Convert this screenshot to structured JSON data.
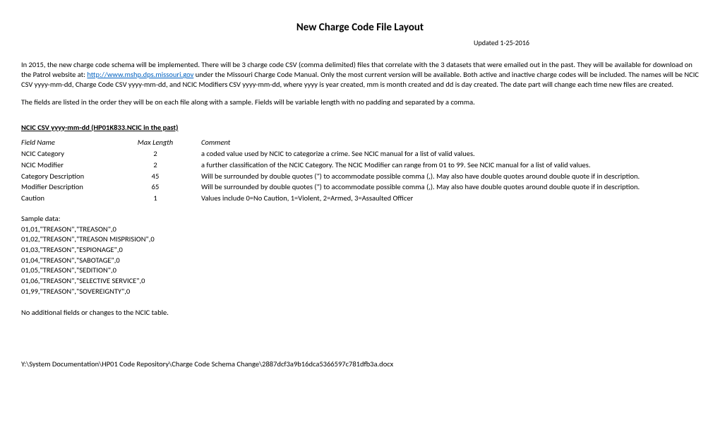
{
  "title": "New Charge Code File Layout",
  "updated": "Updated 1-25-2016",
  "intro": {
    "p1_pre": "In 2015, the new charge code schema will be implemented.  There will be 3 charge code CSV (comma delimited) files that correlate with the 3 datasets that were emailed out in the past.  They will be available for download on the Patrol website at: ",
    "link_text": "http://www.mshp.dps.missouri.gov",
    "p1_post": "  under the Missouri Charge Code Manual.  Only the most current version will be available.  Both active and inactive charge codes will be included.  The names will be NCIC CSV yyyy-mm-dd, Charge Code CSV yyyy-mm-dd, and NCIC Modifiers CSV yyyy-mm-dd, where yyyy is year created, mm is month created and dd is day created.  The date part will change each time new files are created.",
    "p2": "The fields are listed in the order they will be on each file along with a sample.  Fields will be variable length with no padding and separated by a comma."
  },
  "section_heading": "NCIC CSV yyyy-mm-dd (HP01K833.NCIC in the past)",
  "table": {
    "headers": {
      "name": "Field Name",
      "len": "Max Length",
      "comment": "Comment"
    },
    "rows": [
      {
        "name": "NCIC Category",
        "len": "2",
        "comment": "a coded value used by NCIC to categorize a crime.  See NCIC manual for a list of valid values."
      },
      {
        "name": "NCIC Modifier",
        "len": "2",
        "comment": "a further classification of the NCIC Category.  The NCIC Modifier can range from 01 to 99.  See NCIC manual for a list of valid values."
      },
      {
        "name": "Category Description",
        "len": "45",
        "comment": "Will be surrounded by double quotes (\") to accommodate possible comma (,).  May also have double quotes around double quote if in description."
      },
      {
        "name": "Modifier Description",
        "len": "65",
        "comment": "Will be surrounded by double quotes (\") to accommodate possible comma (,).  May also have double quotes around double quote if in description."
      },
      {
        "name": "Caution",
        "len": "1",
        "comment": "Values include 0=No Caution, 1=Violent, 2=Armed, 3=Assaulted Officer"
      }
    ]
  },
  "sample": {
    "label": "Sample data:",
    "lines": [
      "01,01,\"TREASON\",\"TREASON\",0",
      "01,02,\"TREASON\",\"TREASON MISPRISION\",0",
      "01,03,\"TREASON\",\"ESPIONAGE\",0",
      "01,04,\"TREASON\",\"SABOTAGE\",0",
      "01,05,\"TREASON\",\"SEDITION\",0",
      "01,06,\"TREASON\",\"SELECTIVE SERVICE\",0",
      "01,99,\"TREASON\",\"SOVEREIGNTY\",0"
    ]
  },
  "closing": "No additional fields or changes to the NCIC table.",
  "footer_path": "Y:\\System Documentation\\HP01 Code Repository\\Charge Code Schema Change\\2887dcf3a9b16dca5366597c781dfb3a.docx"
}
